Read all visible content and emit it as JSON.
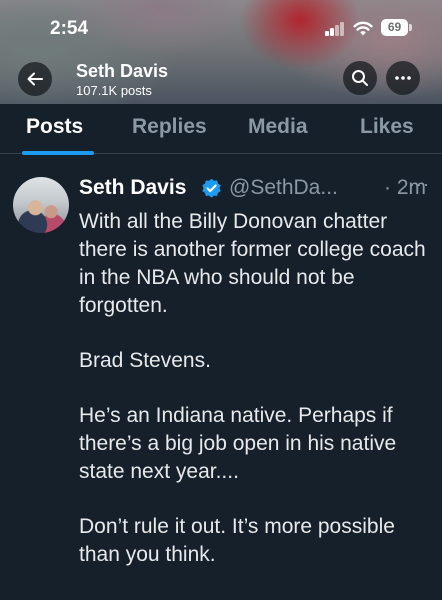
{
  "status_bar": {
    "time": "2:54",
    "battery": "69"
  },
  "header": {
    "name": "Seth Davis",
    "posts_count": "107.1K posts"
  },
  "tabs": [
    {
      "label": "Posts",
      "active": true
    },
    {
      "label": "Replies",
      "active": false
    },
    {
      "label": "Media",
      "active": false
    },
    {
      "label": "Likes",
      "active": false
    }
  ],
  "tweet": {
    "author_name": "Seth Davis",
    "handle": "@SethDa...",
    "time": "· 2m",
    "paragraphs": [
      "With all the Billy Donovan chatter there is another former college coach in the NBA who should not be forgotten.",
      "Brad Stevens.",
      "He’s an Indiana native. Perhaps if there’s a big job open in his native state next year....",
      "Don’t rule it out. It’s more possible than you think."
    ]
  },
  "colors": {
    "background": "#15202b",
    "accent": "#1d9bf0",
    "muted_text": "#8b98a5",
    "primary_text": "#e7e9ea"
  },
  "icons": {
    "back": "arrow-left-icon",
    "search": "search-icon",
    "more": "more-horizontal-icon",
    "verified": "verified-badge-icon",
    "signal": "cellular-signal-icon",
    "wifi": "wifi-icon",
    "battery": "battery-icon"
  }
}
